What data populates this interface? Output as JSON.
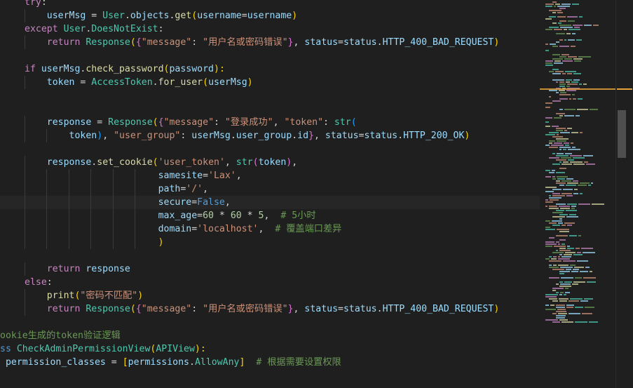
{
  "editor": {
    "lines": [
      [
        [
          "try",
          "kw"
        ],
        [
          ":",
          "op"
        ]
      ],
      [
        [
          "    ",
          "op"
        ],
        [
          "userMsg",
          "var"
        ],
        [
          " = ",
          "op"
        ],
        [
          "User",
          "cls"
        ],
        [
          ".",
          "op"
        ],
        [
          "objects",
          "var"
        ],
        [
          ".",
          "op"
        ],
        [
          "get",
          "fn"
        ],
        [
          "(",
          "p1"
        ],
        [
          "username",
          "var"
        ],
        [
          "=",
          "op"
        ],
        [
          "username",
          "var"
        ],
        [
          ")",
          "p1"
        ]
      ],
      [
        [
          "except ",
          "kw"
        ],
        [
          "User",
          "cls"
        ],
        [
          ".",
          "op"
        ],
        [
          "DoesNotExist",
          "cls"
        ],
        [
          ":",
          "op"
        ]
      ],
      [
        [
          "    ",
          "op"
        ],
        [
          "return ",
          "kw"
        ],
        [
          "Response",
          "cls"
        ],
        [
          "(",
          "p1"
        ],
        [
          "{",
          "p2"
        ],
        [
          "\"message\"",
          "str"
        ],
        [
          ": ",
          "op"
        ],
        [
          "\"用户名或密码错误\"",
          "str"
        ],
        [
          "}",
          "p2"
        ],
        [
          ", ",
          "op"
        ],
        [
          "status",
          "var"
        ],
        [
          "=",
          "op"
        ],
        [
          "status",
          "var"
        ],
        [
          ".",
          "op"
        ],
        [
          "HTTP_400_BAD_REQUEST",
          "var"
        ],
        [
          ")",
          "p1"
        ]
      ],
      [],
      [
        [
          "if ",
          "kw"
        ],
        [
          "userMsg",
          "var"
        ],
        [
          ".",
          "op"
        ],
        [
          "check_password",
          "fn"
        ],
        [
          "(",
          "p1"
        ],
        [
          "password",
          "var"
        ],
        [
          "):",
          "p1"
        ]
      ],
      [
        [
          "    ",
          "op"
        ],
        [
          "token",
          "var"
        ],
        [
          " = ",
          "op"
        ],
        [
          "AccessToken",
          "cls"
        ],
        [
          ".",
          "op"
        ],
        [
          "for_user",
          "fn"
        ],
        [
          "(",
          "p1"
        ],
        [
          "userMsg",
          "var"
        ],
        [
          ")",
          "p1"
        ]
      ],
      [],
      [],
      [
        [
          "    ",
          "op"
        ],
        [
          "response",
          "var"
        ],
        [
          " = ",
          "op"
        ],
        [
          "Response",
          "cls"
        ],
        [
          "(",
          "p1"
        ],
        [
          "{",
          "p2"
        ],
        [
          "\"message\"",
          "str"
        ],
        [
          ": ",
          "op"
        ],
        [
          "\"登录成功\"",
          "str"
        ],
        [
          ", ",
          "op"
        ],
        [
          "\"token\"",
          "str"
        ],
        [
          ": ",
          "op"
        ],
        [
          "str",
          "cls"
        ],
        [
          "(",
          "p3"
        ]
      ],
      [
        [
          "        ",
          "op"
        ],
        [
          "token",
          "var"
        ],
        [
          ")",
          "p3"
        ],
        [
          ", ",
          "op"
        ],
        [
          "\"user_group\"",
          "str"
        ],
        [
          ": ",
          "op"
        ],
        [
          "userMsg",
          "var"
        ],
        [
          ".",
          "op"
        ],
        [
          "user_group",
          "var"
        ],
        [
          ".",
          "op"
        ],
        [
          "id",
          "var"
        ],
        [
          "}",
          "p2"
        ],
        [
          ", ",
          "op"
        ],
        [
          "status",
          "var"
        ],
        [
          "=",
          "op"
        ],
        [
          "status",
          "var"
        ],
        [
          ".",
          "op"
        ],
        [
          "HTTP_200_OK",
          "var"
        ],
        [
          ")",
          "p1"
        ]
      ],
      [],
      [
        [
          "    ",
          "op"
        ],
        [
          "response",
          "var"
        ],
        [
          ".",
          "op"
        ],
        [
          "set_cookie",
          "fn"
        ],
        [
          "(",
          "p1"
        ],
        [
          "'user_token'",
          "str"
        ],
        [
          ", ",
          "op"
        ],
        [
          "str",
          "cls"
        ],
        [
          "(",
          "p2"
        ],
        [
          "token",
          "var"
        ],
        [
          ")",
          "p2"
        ],
        [
          ",",
          "op"
        ]
      ],
      [
        [
          "                        ",
          "op"
        ],
        [
          "samesite",
          "var"
        ],
        [
          "=",
          "op"
        ],
        [
          "'Lax'",
          "str"
        ],
        [
          ",",
          "op"
        ]
      ],
      [
        [
          "                        ",
          "op"
        ],
        [
          "path",
          "var"
        ],
        [
          "=",
          "op"
        ],
        [
          "'/'",
          "str"
        ],
        [
          ",",
          "op"
        ]
      ],
      [
        [
          "                        ",
          "op"
        ],
        [
          "secure",
          "var"
        ],
        [
          "=",
          "op"
        ],
        [
          "False",
          "kw2"
        ],
        [
          ",",
          "op"
        ]
      ],
      [
        [
          "                        ",
          "op"
        ],
        [
          "max_age",
          "var"
        ],
        [
          "=",
          "op"
        ],
        [
          "60",
          "num"
        ],
        [
          " * ",
          "op"
        ],
        [
          "60",
          "num"
        ],
        [
          " * ",
          "op"
        ],
        [
          "5",
          "num"
        ],
        [
          ",  ",
          "op"
        ],
        [
          "# 5小时",
          "cmt"
        ]
      ],
      [
        [
          "                        ",
          "op"
        ],
        [
          "domain",
          "var"
        ],
        [
          "=",
          "op"
        ],
        [
          "'localhost'",
          "str"
        ],
        [
          ",  ",
          "op"
        ],
        [
          "# 覆盖端口差异",
          "cmt"
        ]
      ],
      [
        [
          "                        ",
          "op"
        ],
        [
          ")",
          "p1"
        ]
      ],
      [],
      [
        [
          "    ",
          "op"
        ],
        [
          "return ",
          "kw"
        ],
        [
          "response",
          "var"
        ]
      ],
      [
        [
          "else",
          "kw"
        ],
        [
          ":",
          "op"
        ]
      ],
      [
        [
          "    ",
          "op"
        ],
        [
          "print",
          "fn"
        ],
        [
          "(",
          "p1"
        ],
        [
          "\"密码不匹配\"",
          "str"
        ],
        [
          ")",
          "p1"
        ]
      ],
      [
        [
          "    ",
          "op"
        ],
        [
          "return ",
          "kw"
        ],
        [
          "Response",
          "cls"
        ],
        [
          "(",
          "p1"
        ],
        [
          "{",
          "p2"
        ],
        [
          "\"message\"",
          "str"
        ],
        [
          ": ",
          "op"
        ],
        [
          "\"用户名或密码错误\"",
          "str"
        ],
        [
          "}",
          "p2"
        ],
        [
          ", ",
          "op"
        ],
        [
          "status",
          "var"
        ],
        [
          "=",
          "op"
        ],
        [
          "status",
          "var"
        ],
        [
          ".",
          "op"
        ],
        [
          "HTTP_400_BAD_REQUEST",
          "var"
        ],
        [
          ")",
          "p1"
        ]
      ],
      [],
      [
        [
          "ookie生成的token验证逻辑",
          "cmt"
        ]
      ],
      [
        [
          "ss ",
          "kw2"
        ],
        [
          "CheckAdminPermissionView",
          "cls"
        ],
        [
          "(",
          "p1"
        ],
        [
          "APIView",
          "cls"
        ],
        [
          "):",
          "p1"
        ]
      ],
      [
        [
          " permission_classes",
          "var"
        ],
        [
          " = ",
          "op"
        ],
        [
          "[",
          "p1"
        ],
        [
          "permissions",
          "var"
        ],
        [
          ".",
          "op"
        ],
        [
          "AllowAny",
          "cls"
        ],
        [
          "]",
          "p1"
        ],
        [
          "  ",
          "op"
        ],
        [
          "# 根据需要设置权限",
          "cmt"
        ]
      ]
    ]
  },
  "colors": {
    "background": "#1f1f1f",
    "keyword": "#c586c0",
    "variable": "#9cdcfe",
    "class": "#4ec9b0",
    "function": "#dcdcaa",
    "string": "#ce9178",
    "comment": "#6a9955",
    "number": "#b5cea8",
    "minimap_highlight": "#e5a13a"
  }
}
